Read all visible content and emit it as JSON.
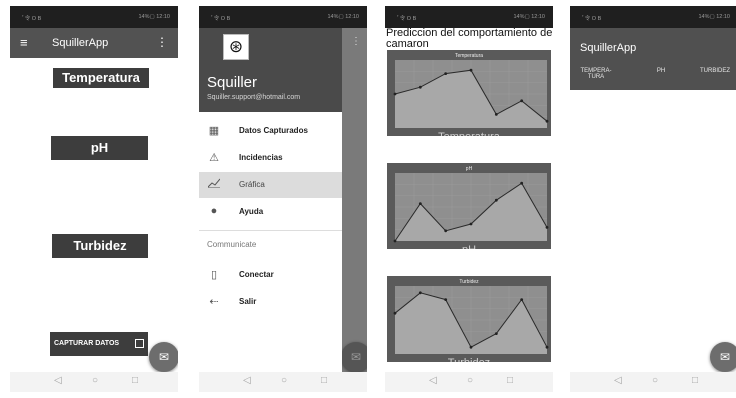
{
  "status": {
    "left": "ﾟ令 O B",
    "right": "14%▢ 12:10"
  },
  "nav": {
    "back": "◁",
    "home": "○",
    "recents": "□"
  },
  "screen1": {
    "appbar_title": "SquillerApp",
    "menu_icon": "≡",
    "more_icon": "⋮",
    "buttons": [
      "Temperatura",
      "pH",
      "Turbidez"
    ],
    "capture_label": "CAPTURAR DATOS",
    "fab_icon": "✉"
  },
  "screen2": {
    "logo_glyph": "⊛",
    "user_name": "Squiller",
    "user_email": "Squiller.support@hotmail.com",
    "items": [
      {
        "label": "Datos Capturados",
        "icon": "▦"
      },
      {
        "label": "Incidencias",
        "icon": "⚠"
      },
      {
        "label": "Gráfica",
        "icon": "📈"
      },
      {
        "label": "Ayuda",
        "icon": "●"
      }
    ],
    "section_label": "Communicate",
    "items2": [
      {
        "label": "Conectar",
        "icon": "▯"
      },
      {
        "label": "Salir",
        "icon": "⇠"
      }
    ],
    "more_icon": "⋮",
    "fab_icon": "✉"
  },
  "screen3": {
    "title": "Prediccion del comportamiento del camaron",
    "chart_data": [
      {
        "type": "area",
        "title": "Temperatura",
        "xlabel": "Temperatura",
        "x": [
          0,
          1,
          2,
          3,
          4,
          5,
          6
        ],
        "values": [
          5,
          6,
          8,
          8.5,
          2,
          4,
          1
        ],
        "ylim": [
          0,
          10
        ]
      },
      {
        "type": "area",
        "title": "pH",
        "xlabel": "pH",
        "x": [
          0,
          1,
          2,
          3,
          4,
          5,
          6
        ],
        "values": [
          0,
          5.5,
          1.5,
          2.5,
          6,
          8.5,
          2
        ],
        "ylim": [
          0,
          10
        ]
      },
      {
        "type": "area",
        "title": "Turbidez",
        "xlabel": "Turbidez",
        "x": [
          0,
          1,
          2,
          3,
          4,
          5,
          6
        ],
        "values": [
          6,
          9,
          8,
          1,
          3,
          8,
          1
        ],
        "ylim": [
          0,
          10
        ]
      }
    ]
  },
  "screen4": {
    "title": "SquillerApp",
    "columns": [
      "TEMPERA-\nTURA",
      "PH",
      "TURBIDEZ"
    ],
    "fab_icon": "✉"
  },
  "colors": {
    "appbar": "#525252",
    "button": "#3d3d3d",
    "fab": "#6d6d6d",
    "chart_fill": "#a8a8a8"
  }
}
